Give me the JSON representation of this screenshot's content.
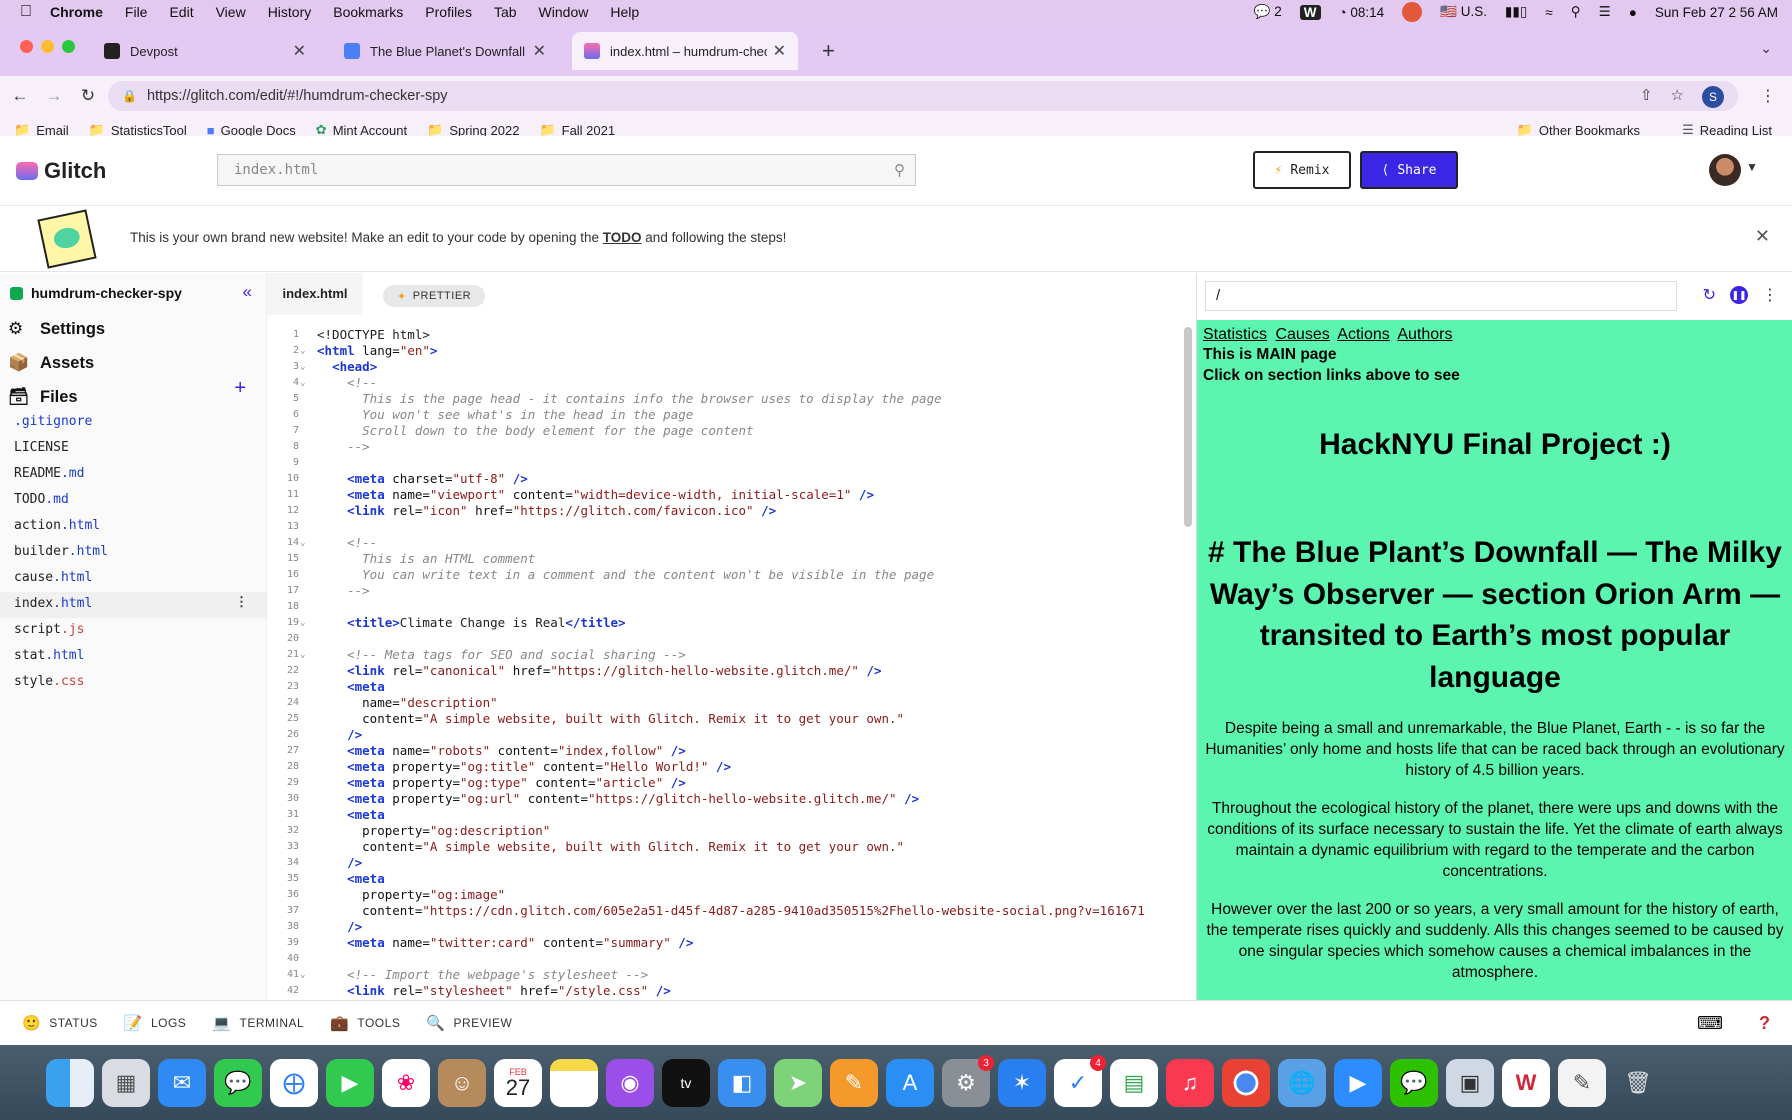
{
  "menubar": {
    "app": "Chrome",
    "items": [
      "File",
      "Edit",
      "View",
      "History",
      "Bookmarks",
      "Profiles",
      "Tab",
      "Window",
      "Help"
    ],
    "wechat_count": "2",
    "clock": "08:14",
    "input": "U.S.",
    "datetime": "Sun Feb 27  2 56 AM"
  },
  "tabs": [
    {
      "title": "Devpost",
      "active": false
    },
    {
      "title": "The Blue Planet's Downfall - Go",
      "active": false
    },
    {
      "title": "index.html – humdrum-checker",
      "active": true
    }
  ],
  "url": "https://glitch.com/edit/#!/humdrum-checker-spy",
  "profile_initial": "S",
  "bookmarks": [
    "Email",
    "StatisticsTool",
    "Google Docs",
    "Mint Account",
    "Spring 2022",
    "Fall 2021"
  ],
  "bookmarks_right": [
    "Other Bookmarks",
    "Reading List"
  ],
  "glitch": {
    "logo": "Glitch",
    "search_placeholder": "index.html",
    "remix": "Remix",
    "share": "Share"
  },
  "banner": {
    "before": "This is your own brand new website! Make an edit to your code by opening the ",
    "link": "TODO",
    "after": " and following the steps!"
  },
  "sidebar": {
    "project": "humdrum-checker-spy",
    "nav": [
      "Settings",
      "Assets",
      "Files"
    ],
    "files": [
      {
        "name": ".gitignore",
        "ext": ""
      },
      {
        "name": "LICENSE",
        "ext": ""
      },
      {
        "name": "README",
        "ext": ".md"
      },
      {
        "name": "TODO",
        "ext": ".md"
      },
      {
        "name": "action",
        "ext": ".html"
      },
      {
        "name": "builder",
        "ext": ".html"
      },
      {
        "name": "cause",
        "ext": ".html"
      },
      {
        "name": "index",
        "ext": ".html"
      },
      {
        "name": "script",
        "ext": ".js"
      },
      {
        "name": "stat",
        "ext": ".html"
      },
      {
        "name": "style",
        "ext": ".css"
      }
    ]
  },
  "editor": {
    "tab": "index.html",
    "prettier": "PRETTIER"
  },
  "preview": {
    "path": "/",
    "links": [
      "Statistics",
      "Causes",
      "Actions",
      "Authors"
    ],
    "main": "This is MAIN page",
    "click": "Click on section links above to see",
    "h1": "HackNYU Final Project :)",
    "h2": "# The Blue Plant’s Downfall — The Milky Way’s Observer — section Orion Arm — transited to Earth’s most popular language",
    "p1": "Despite being a small and unremarkable, the Blue Planet, Earth - - is so far the Humanities’ only home and hosts life that can be raced back through an evolutionary history of 4.5 billion years.",
    "p2": "Throughout the ecological history of the planet, there were ups and downs with the conditions of its surface necessary to sustain the life. Yet the climate of earth always maintain a dynamic equilibrium with regard to the temperate and the carbon concentrations.",
    "p3": "However over the last 200 or so years, a very small amount for the history of earth, the temperate rises quickly and suddenly. Alls this changes seemed to be caused by one singular species which somehow causes a chemical imbalances in the atmosphere."
  },
  "bottombar": [
    "STATUS",
    "LOGS",
    "TERMINAL",
    "TOOLS",
    "PREVIEW"
  ],
  "dock_calendar": {
    "month": "FEB",
    "day": "27"
  },
  "dock_badges": {
    "settings": "3",
    "reminders": "4"
  }
}
